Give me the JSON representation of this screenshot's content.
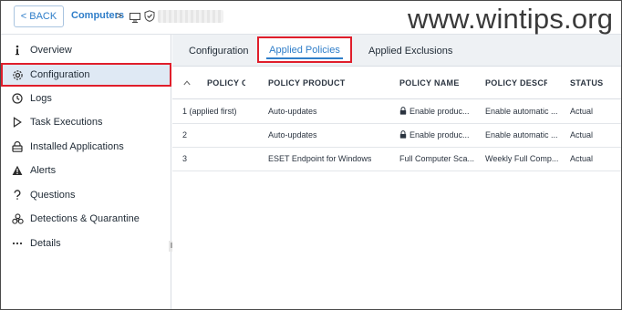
{
  "header": {
    "back_label": "< BACK",
    "breadcrumb_link": "Computers",
    "chevron": ">",
    "watermark": "www.wintips.org"
  },
  "sidebar": {
    "items": [
      {
        "label": "Overview",
        "icon": "info-icon"
      },
      {
        "label": "Configuration",
        "icon": "gear-icon"
      },
      {
        "label": "Logs",
        "icon": "clock-icon"
      },
      {
        "label": "Task Executions",
        "icon": "play-icon"
      },
      {
        "label": "Installed Applications",
        "icon": "apps-lock-icon"
      },
      {
        "label": "Alerts",
        "icon": "alert-icon"
      },
      {
        "label": "Questions",
        "icon": "question-icon"
      },
      {
        "label": "Detections & Quarantine",
        "icon": "biohazard-icon"
      },
      {
        "label": "Details",
        "icon": "more-icon"
      }
    ],
    "active_index": 1
  },
  "tabs": [
    {
      "label": "Configuration"
    },
    {
      "label": "Applied Policies"
    },
    {
      "label": "Applied Exclusions"
    }
  ],
  "table": {
    "columns": [
      "POLICY O",
      "POLICY PRODUCT",
      "POLICY NAME",
      "POLICY DESCRI",
      "STATUS"
    ],
    "rows": [
      {
        "order": "1 (applied first)",
        "product": "Auto-updates",
        "name": "Enable produc...",
        "name_locked": true,
        "description": "Enable automatic ...",
        "status": "Actual"
      },
      {
        "order": "2",
        "product": "Auto-updates",
        "name": "Enable produc...",
        "name_locked": true,
        "description": "Enable automatic ...",
        "status": "Actual"
      },
      {
        "order": "3",
        "product": "ESET Endpoint for Windows",
        "name": "Full Computer Sca...",
        "name_locked": false,
        "description": "Weekly Full Comp...",
        "status": "Actual"
      }
    ]
  },
  "colors": {
    "accent": "#2f7ec9",
    "highlight_border": "#e01e2b",
    "active_bg": "#dfe9f4"
  }
}
